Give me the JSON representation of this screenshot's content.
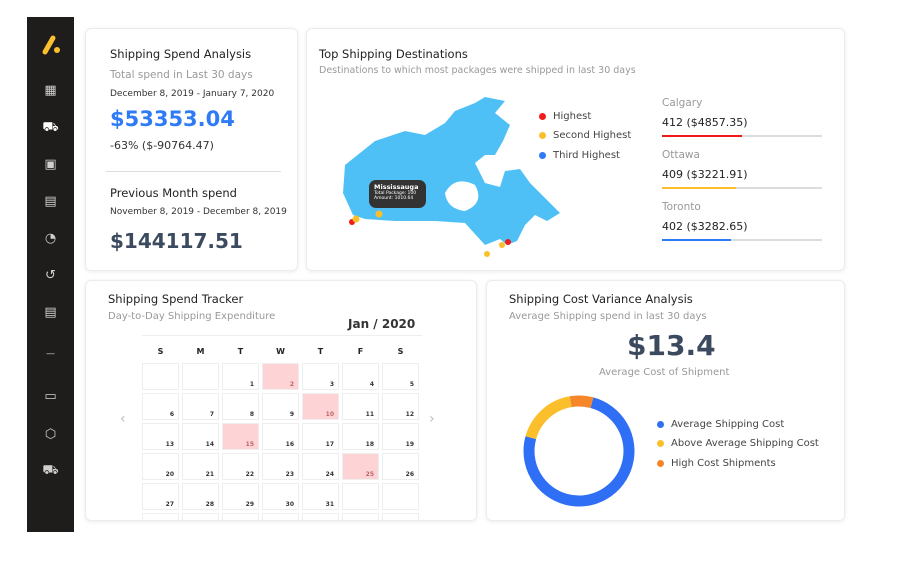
{
  "sidebar": {
    "items": [
      {
        "icon": "logo-icon"
      },
      {
        "icon": "dashboard-icon"
      },
      {
        "icon": "truck-icon"
      },
      {
        "icon": "money-icon"
      },
      {
        "icon": "payments-icon"
      },
      {
        "icon": "timer-icon"
      },
      {
        "icon": "history-icon"
      },
      {
        "icon": "document-icon"
      },
      {
        "icon": "more-icon"
      },
      {
        "icon": "contact-card-icon"
      },
      {
        "icon": "box-icon"
      },
      {
        "icon": "delivery-truck-icon"
      }
    ]
  },
  "spend": {
    "title": "Shipping Spend Analysis",
    "subtitle": "Total spend in Last 30 days",
    "range": "December 8, 2019 - January 7, 2020",
    "total": "$53353.04",
    "change": "-63% ($-90764.47)",
    "prev_title": "Previous Month spend",
    "prev_range": "November 8, 2019 - December 8, 2019",
    "prev_total": "$144117.51"
  },
  "destinations": {
    "title": "Top Shipping Destinations",
    "subtitle": "Destinations to which most packages were shipped in last 30 days",
    "legend": [
      {
        "label": "Highest",
        "color": "#f01c1c"
      },
      {
        "label": "Second Highest",
        "color": "#fbbf2b"
      },
      {
        "label": "Third Highest",
        "color": "#2f7bf5"
      }
    ],
    "tooltip": {
      "city": "Mississauga",
      "packages": "Total Package: 100",
      "amount": "Amount: 1010.64"
    },
    "cities": [
      {
        "name": "Calgary",
        "value": "412 ($4857.35)",
        "fill": 0.5,
        "color": "#f01c1c"
      },
      {
        "name": "Ottawa",
        "value": "409 ($3221.91)",
        "fill": 0.46,
        "color": "#fbbf2b"
      },
      {
        "name": "Toronto",
        "value": "402 ($3282.65)",
        "fill": 0.43,
        "color": "#2f7bf5"
      }
    ],
    "map_color": "#4fc0f5"
  },
  "tracker": {
    "title": "Shipping Spend Tracker",
    "subtitle": "Day-to-Day Shipping Expenditure",
    "month": "Jan / 2020",
    "weekdays": [
      "S",
      "M",
      "T",
      "W",
      "T",
      "F",
      "S"
    ],
    "first_weekday": 2,
    "days": 31,
    "highlighted": [
      2,
      10,
      15,
      25
    ]
  },
  "variance": {
    "title": "Shipping Cost Variance Analysis",
    "subtitle": "Average Shipping spend in last 30 days",
    "value": "$13.4",
    "value_label": "Average Cost of Shipment",
    "segments": [
      {
        "label": "Average Shipping Cost",
        "color": "#2f6ff5",
        "share": 75
      },
      {
        "label": "Above Average Shipping Cost",
        "color": "#fbbf2b",
        "share": 18
      },
      {
        "label": "High Cost Shipments",
        "color": "#f7862a",
        "share": 7
      }
    ]
  }
}
